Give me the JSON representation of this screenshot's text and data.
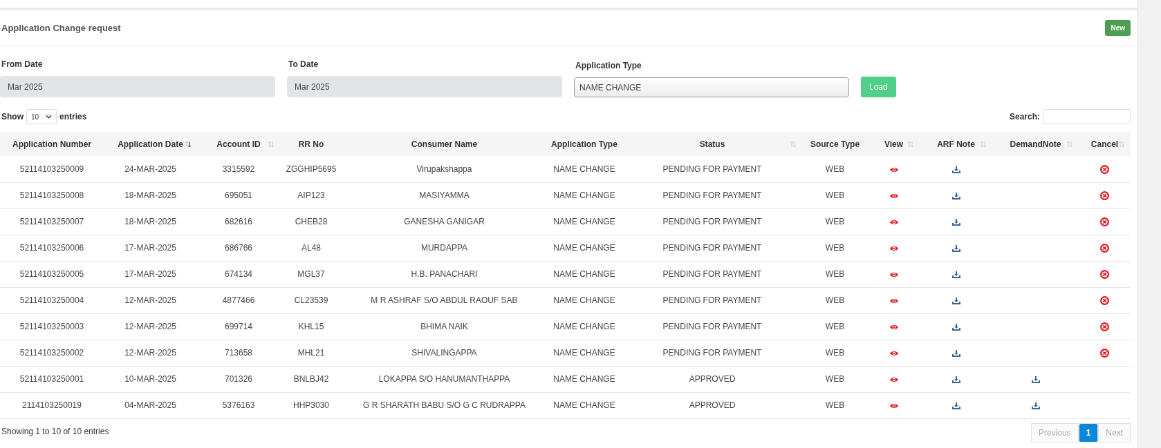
{
  "panel": {
    "title": "Application Change request",
    "new_button": "New"
  },
  "filters": [
    {
      "kind": "readonly",
      "label": "From Date",
      "value": "Mar 2025"
    },
    {
      "kind": "readonly",
      "label": "To Date",
      "value": "Mar 2025"
    },
    {
      "kind": "select",
      "label": "Application Type",
      "value": "NAME CHANGE"
    }
  ],
  "load_button": "Load",
  "length": {
    "before": "Show",
    "value": "10",
    "after": "entries"
  },
  "search": {
    "label": "Search:"
  },
  "table": {
    "columns": [
      {
        "label": "Application Number",
        "sortable": false
      },
      {
        "label": "Application Date",
        "sortable": true,
        "sorted": true
      },
      {
        "label": "Account ID",
        "sortable": true,
        "sorted": false
      },
      {
        "label": "RR No",
        "sortable": false
      },
      {
        "label": "Consumer Name",
        "sortable": false
      },
      {
        "label": "Application Type",
        "sortable": false
      },
      {
        "label": "Status",
        "sortable": true,
        "sorted": false
      },
      {
        "label": "Source Type",
        "sortable": false
      },
      {
        "label": "View",
        "sortable": true,
        "sorted": false
      },
      {
        "label": "ARF Note",
        "sortable": true,
        "sorted": false
      },
      {
        "label": "DemandNote",
        "sortable": true,
        "sorted": false
      },
      {
        "label": "Cancel",
        "sortable": true,
        "sorted": false
      }
    ],
    "rows": [
      {
        "cells": [
          "52114103250009",
          "24-MAR-2025",
          "3315592",
          "ZGGHIP5695",
          "Virupakshappa",
          "NAME CHANGE",
          "PENDING FOR PAYMENT",
          "WEB"
        ],
        "demand_note": false,
        "cancel": true
      },
      {
        "cells": [
          "52114103250008",
          "18-MAR-2025",
          "695051",
          "AIP123",
          "MASIYAMMA",
          "NAME CHANGE",
          "PENDING FOR PAYMENT",
          "WEB"
        ],
        "demand_note": false,
        "cancel": true
      },
      {
        "cells": [
          "52114103250007",
          "18-MAR-2025",
          "682616",
          "CHEB28",
          "GANESHA GANIGAR",
          "NAME CHANGE",
          "PENDING FOR PAYMENT",
          "WEB"
        ],
        "demand_note": false,
        "cancel": true
      },
      {
        "cells": [
          "52114103250006",
          "17-MAR-2025",
          "686766",
          "AL48",
          "MURDAPPA",
          "NAME CHANGE",
          "PENDING FOR PAYMENT",
          "WEB"
        ],
        "demand_note": false,
        "cancel": true
      },
      {
        "cells": [
          "52114103250005",
          "17-MAR-2025",
          "674134",
          "MGL37",
          "H.B. PANACHARI",
          "NAME CHANGE",
          "PENDING FOR PAYMENT",
          "WEB"
        ],
        "demand_note": false,
        "cancel": true
      },
      {
        "cells": [
          "52114103250004",
          "12-MAR-2025",
          "4877466",
          "CL23539",
          "M R ASHRAF S/O ABDUL RAOUF SAB",
          "NAME CHANGE",
          "PENDING FOR PAYMENT",
          "WEB"
        ],
        "demand_note": false,
        "cancel": true
      },
      {
        "cells": [
          "52114103250003",
          "12-MAR-2025",
          "699714",
          "KHL15",
          "BHIMA NAIK",
          "NAME CHANGE",
          "PENDING FOR PAYMENT",
          "WEB"
        ],
        "demand_note": false,
        "cancel": true
      },
      {
        "cells": [
          "52114103250002",
          "12-MAR-2025",
          "713658",
          "MHL21",
          "SHIVALINGAPPA",
          "NAME CHANGE",
          "PENDING FOR PAYMENT",
          "WEB"
        ],
        "demand_note": false,
        "cancel": true
      },
      {
        "cells": [
          "52114103250001",
          "10-MAR-2025",
          "701326",
          "BNLBJ42",
          "LOKAPPA S/O HANUMANTHAPPA",
          "NAME CHANGE",
          "APPROVED",
          "WEB"
        ],
        "demand_note": true,
        "cancel": false
      },
      {
        "cells": [
          "2114103250019",
          "04-MAR-2025",
          "5376163",
          "HHP3030",
          "G R SHARATH BABU S/O G C RUDRAPPA",
          "NAME CHANGE",
          "APPROVED",
          "WEB"
        ],
        "demand_note": true,
        "cancel": false
      }
    ]
  },
  "info": "Showing 1 to 10 of 10 entries",
  "pagination": [
    {
      "label": "Previous",
      "selected": false,
      "disabled": true
    },
    {
      "label": "1",
      "selected": true,
      "disabled": false
    },
    {
      "label": "Next",
      "selected": false,
      "disabled": true
    }
  ]
}
